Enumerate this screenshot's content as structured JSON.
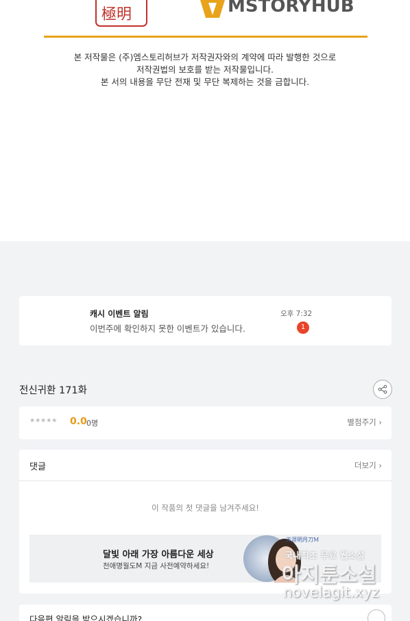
{
  "publisher_logo_text": "MSTORYHUB",
  "copyright": {
    "line1": "본 저작물은 (주)엠스토리허브가 저작권자와의 계약에 따라 발행한 것으로",
    "line2": "저작권법의 보호를 받는 저작물입니다.",
    "line3": "본 서의 내용을 무단 전재 및 무단 복제하는 것을 금합니다."
  },
  "notice": {
    "title": "캐시 이벤트 알림",
    "message": "이번주에 확인하지 못한 이벤트가 있습니다.",
    "time": "오후 7:32",
    "badge": "1"
  },
  "episode": {
    "title": "전신귀환 171화"
  },
  "rating": {
    "stars": "★★★★★",
    "score": "0.0",
    "count": "0명",
    "rate_button": "별점주기 ›"
  },
  "comments": {
    "title": "댓글",
    "more": "더보기 ›",
    "empty": "이 작품의 첫 댓글을 남겨주세요!"
  },
  "banner": {
    "title": "달빛 아래 가장 아름다운 세상",
    "subtitle": "천애명월도M 지금 사전예약하세요!"
  },
  "next_alert": {
    "text": "다음편 알림을 받으시겠습니까?"
  },
  "watermark": {
    "line1": "국내최초 무료 웹소설",
    "line2": "아지툰소설",
    "line3": "novelagit.xyz"
  },
  "colors": {
    "accent": "#e8a31a",
    "badge": "#e8442a",
    "score": "#e89a1a",
    "background": "#f2f3f5"
  }
}
